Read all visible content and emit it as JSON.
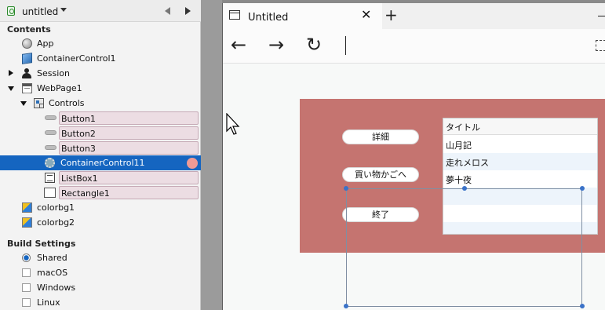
{
  "project": {
    "name": "untitled"
  },
  "navigator": {
    "contents_header": "Contents",
    "items": [
      {
        "label": "App",
        "icon": "globe-icon"
      },
      {
        "label": "ContainerControl1",
        "icon": "cube-icon"
      },
      {
        "label": "Session",
        "icon": "person-icon"
      },
      {
        "label": "WebPage1",
        "icon": "webpage-icon"
      },
      {
        "label": "Controls",
        "icon": "controls-icon"
      },
      {
        "label": "Button1",
        "icon": "button-icon"
      },
      {
        "label": "Button2",
        "icon": "button-icon"
      },
      {
        "label": "Button3",
        "icon": "button-icon"
      },
      {
        "label": "ContainerControl11",
        "icon": "gear-icon"
      },
      {
        "label": "ListBox1",
        "icon": "listbox-icon"
      },
      {
        "label": "Rectangle1",
        "icon": "rectangle-icon"
      },
      {
        "label": "colorbg1",
        "icon": "colorbg-icon"
      },
      {
        "label": "colorbg2",
        "icon": "colorbg-icon"
      }
    ],
    "build_header": "Build Settings",
    "build_items": [
      {
        "label": "Shared"
      },
      {
        "label": "macOS"
      },
      {
        "label": "Windows"
      },
      {
        "label": "Linux"
      }
    ],
    "selection_color": "#1565c0"
  },
  "browser": {
    "tab_title": "Untitled",
    "tab_close": "✕",
    "new_tab": "+",
    "back": "←",
    "forward": "→",
    "reload": "↻"
  },
  "webpage": {
    "container_color": "#c57470",
    "buttons": [
      "詳細",
      "買い物かごへ",
      "終了"
    ],
    "listbox": {
      "header": "タイトル",
      "rows": [
        "山月記",
        "走れメロス",
        "夢十夜"
      ]
    }
  }
}
